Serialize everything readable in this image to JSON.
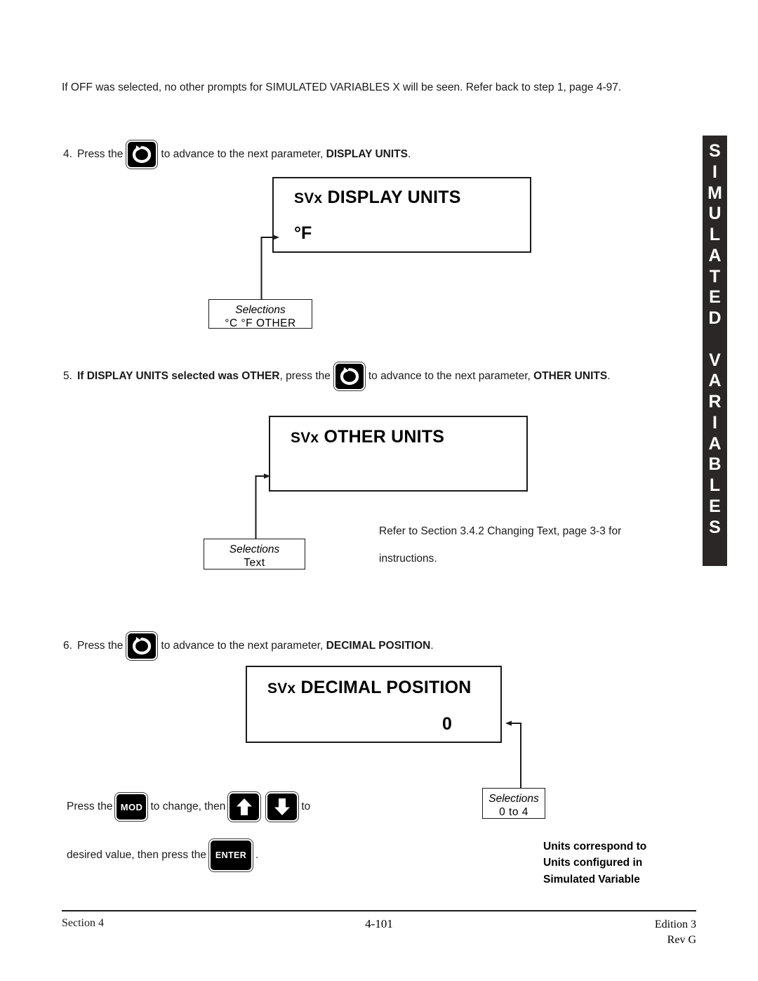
{
  "intro": {
    "text": "If OFF was selected, no other prompts for SIMULATED VARIABLES X will be seen.  Refer back to step 1, page 4-97."
  },
  "steps": {
    "step4": {
      "number": "4.",
      "before": "Press the",
      "after_pre": "to advance to the next parameter,",
      "after_bold": "DISPLAY UNITS",
      "after_end": ".",
      "key": "loop-key"
    },
    "step5": {
      "number": "5.",
      "bold_lead": "If DISPLAY UNITS selected was OTHER",
      "before": ", press the",
      "after_pre": "to advance to the next parameter,",
      "after_bold": "OTHER UNITS",
      "after_end": ".",
      "key": "loop-key"
    },
    "step6": {
      "number": "6.",
      "before": "Press the",
      "after_pre": "to advance to the next parameter,",
      "after_bold": "DECIMAL POSITION",
      "after_end": ".",
      "key": "loop-key"
    }
  },
  "panels": {
    "display_units": {
      "prefix": "SVx",
      "title": "DISPLAY UNITS",
      "value": "°F"
    },
    "other_units": {
      "prefix": "SVx",
      "title": "OTHER  UNITS",
      "value": ""
    },
    "decimal_position": {
      "prefix": "SVx",
      "title": "DECIMAL POSITION",
      "value": "0"
    }
  },
  "selections": {
    "display_units": {
      "title": "Selections",
      "items": "°C    °F   OTHER"
    },
    "other_units": {
      "title": "Selections",
      "items": "Text"
    },
    "decimal_position": {
      "title": "Selections",
      "items": "0 to 4"
    }
  },
  "refer_note": {
    "line1": "Refer to Section 3.4.2 Changing Text, page 3-3 for",
    "line2": "instructions."
  },
  "change_value": {
    "line1_a": "Press the",
    "mod_key": "MOD",
    "line1_b": "to change, then",
    "up_key": "up-arrow",
    "down_key": "down-arrow",
    "line1_c": "to",
    "line2_a": "desired value, then press the",
    "enter_key": "ENTER",
    "line2_b": "."
  },
  "units_note": {
    "line1": "Units correspond to",
    "line2": "Units configured in",
    "line3": "Simulated Variable"
  },
  "side_tab": {
    "characters": [
      "S",
      "I",
      "M",
      "U",
      "L",
      "A",
      "T",
      "E",
      "D",
      "",
      "V",
      "A",
      "R",
      "I",
      "A",
      "B",
      "L",
      "E",
      "S"
    ],
    "background": "#2b2727"
  },
  "footer": {
    "left": "Section 4",
    "center": "4-101",
    "right_line1": "Edition 3",
    "right_line2": "Rev G"
  }
}
